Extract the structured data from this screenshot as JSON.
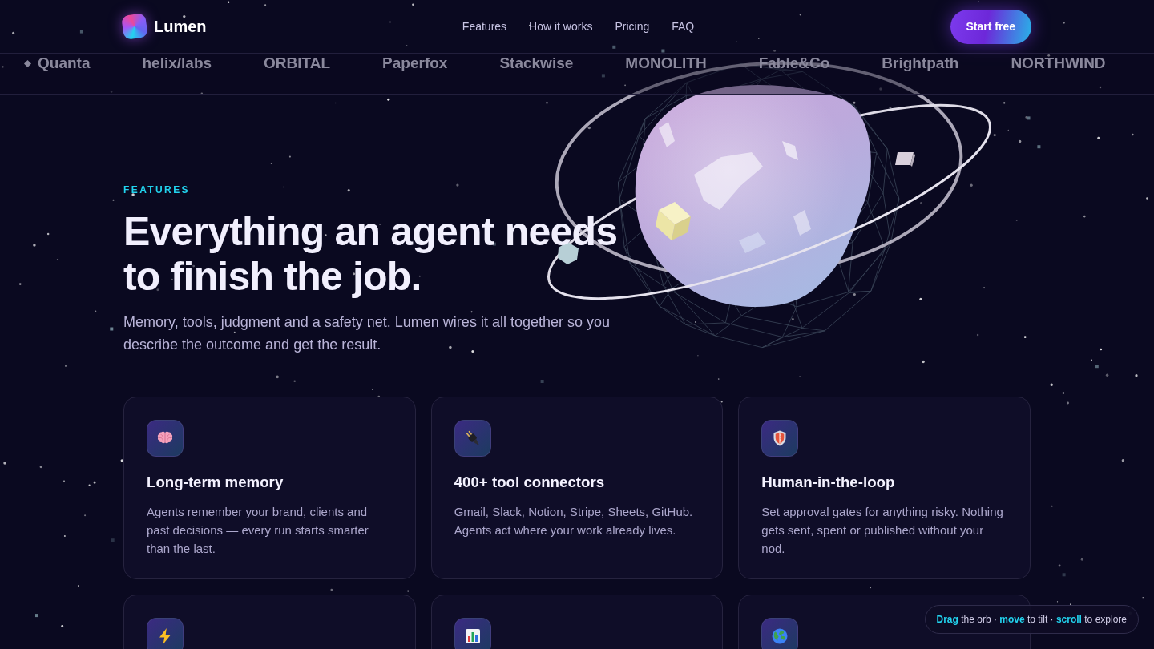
{
  "header": {
    "brand": "Lumen",
    "nav": [
      {
        "label": "Features"
      },
      {
        "label": "How it works"
      },
      {
        "label": "Pricing"
      },
      {
        "label": "FAQ"
      }
    ],
    "cta": "Start free"
  },
  "logo_strip": [
    {
      "kind": "symbol",
      "label": "Quanta"
    },
    {
      "kind": "wordmark",
      "label": "helix/labs"
    },
    {
      "kind": "wordmark",
      "label": "ORBITAL"
    },
    {
      "kind": "wordmark",
      "label": "Paperfox"
    },
    {
      "kind": "wordmark",
      "label": "Stackwise"
    },
    {
      "kind": "wordmark",
      "label": "MONOLITH"
    },
    {
      "kind": "wordmark",
      "label": "Fable&Co"
    },
    {
      "kind": "wordmark",
      "label": "Brightpath"
    },
    {
      "kind": "wordmark",
      "label": "NORTHWIND"
    }
  ],
  "features": {
    "eyebrow": "FEATURES",
    "heading": "Everything an agent needs to finish the job.",
    "subtitle": "Memory, tools, judgment and a safety net. Lumen wires it all together so you describe the outcome and get the result.",
    "cards": [
      {
        "kind": "brain",
        "title": "Long-term memory",
        "text": "Agents remember your brand, clients and past decisions — every run starts smarter than the last."
      },
      {
        "kind": "plug",
        "title": "400+ tool connectors",
        "text": "Gmail, Slack, Notion, Stripe, Sheets, GitHub. Agents act where your work already lives."
      },
      {
        "kind": "shield",
        "title": "Human-in-the-loop",
        "text": "Set approval gates for anything risky. Nothing gets sent, spent or published without your nod."
      },
      {
        "kind": "bolt"
      },
      {
        "kind": "chart"
      },
      {
        "kind": "globe"
      }
    ]
  },
  "hint": "**Drag** the orb · **move** to tilt · **scroll** to explore"
}
